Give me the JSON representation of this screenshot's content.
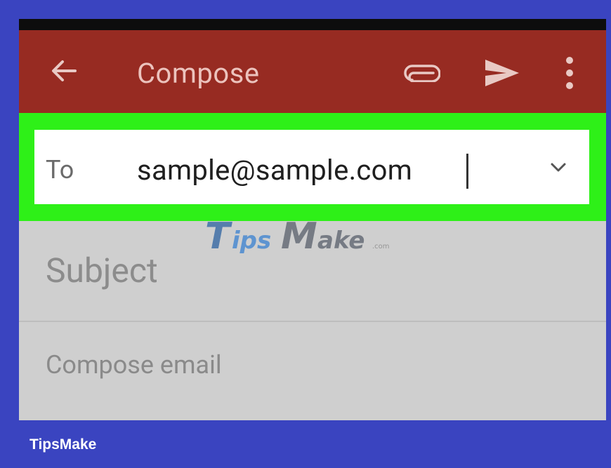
{
  "header": {
    "title": "Compose",
    "icons": [
      "back-arrow-icon",
      "paperclip-icon",
      "send-icon",
      "more-vert-icon"
    ]
  },
  "to_field": {
    "label": "To",
    "value": "sample@sample.com"
  },
  "subject_field": {
    "placeholder": "Subject"
  },
  "body_field": {
    "placeholder": "Compose email"
  },
  "watermark": {
    "text": "TipsMake",
    "suffix": ".com"
  },
  "footer": {
    "brand": "TipsMake"
  },
  "colors": {
    "appbar": "#972b22",
    "highlight": "#2ef018",
    "frame": "#3a44c0",
    "fields": "#cfcfcf"
  }
}
